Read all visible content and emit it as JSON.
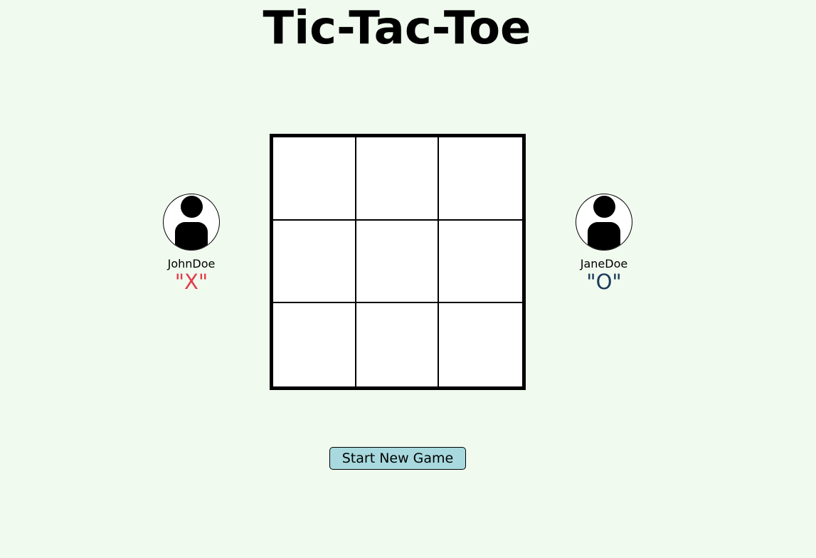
{
  "title": "Tic-Tac-Toe",
  "players": [
    {
      "name": "JohnDoe",
      "symbol": "\"X\"",
      "color": "#e23d4b",
      "icon": "user-avatar-icon"
    },
    {
      "name": "JaneDoe",
      "symbol": "\"O\"",
      "color": "#1b3a5b",
      "icon": "user-avatar-icon"
    }
  ],
  "board": {
    "cells": [
      "",
      "",
      "",
      "",
      "",
      "",
      "",
      "",
      ""
    ]
  },
  "start_button_label": "Start New Game",
  "colors": {
    "background": "#f0faee",
    "button": "#a7d9de"
  }
}
